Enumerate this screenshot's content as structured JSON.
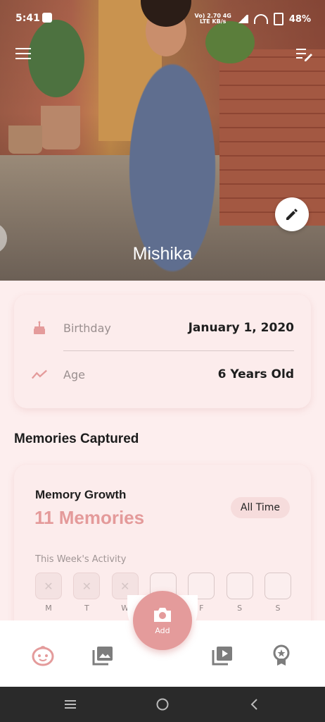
{
  "status_bar": {
    "time": "5:41",
    "network_line1": "Vo) 2.70 4G",
    "network_line2": "LTE KB/s",
    "battery": "48%"
  },
  "profile": {
    "name": "Mishika"
  },
  "info": {
    "birthday_label": "Birthday",
    "birthday_value": "January 1, 2020",
    "age_label": "Age",
    "age_value": "6 Years Old"
  },
  "memories_section": {
    "title": "Memories Captured"
  },
  "memory_growth": {
    "title": "Memory Growth",
    "count": "11 Memories",
    "filter_label": "All Time",
    "week_label": "This Week's Activity",
    "days": [
      {
        "label": "M",
        "state": "missed"
      },
      {
        "label": "T",
        "state": "missed"
      },
      {
        "label": "W",
        "state": "missed"
      },
      {
        "label": "T",
        "state": "pending"
      },
      {
        "label": "F",
        "state": "pending"
      },
      {
        "label": "S",
        "state": "pending"
      },
      {
        "label": "S",
        "state": "pending"
      }
    ]
  },
  "bottom_nav": {
    "add_label": "Add"
  },
  "colors": {
    "accent": "#e49b9b",
    "background": "#fdeeee"
  }
}
